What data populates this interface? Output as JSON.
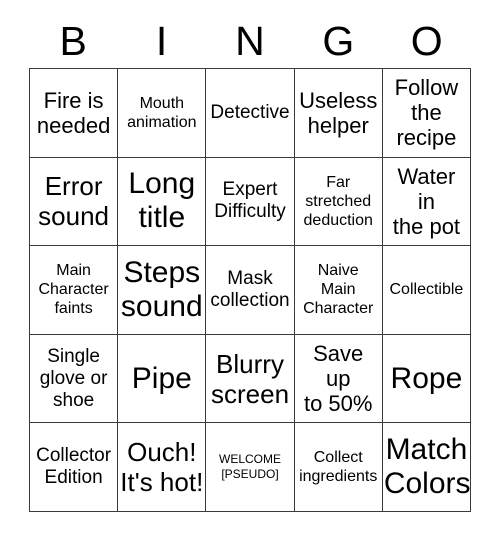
{
  "card": {
    "headers": [
      "B",
      "I",
      "N",
      "G",
      "O"
    ],
    "rows": [
      [
        {
          "text": "Fire is\nneeded",
          "size": "lg"
        },
        {
          "text": "Mouth\nanimation",
          "size": "sm"
        },
        {
          "text": "Detective",
          "size": "md"
        },
        {
          "text": "Useless\nhelper",
          "size": "lg"
        },
        {
          "text": "Follow\nthe\nrecipe",
          "size": "lg"
        }
      ],
      [
        {
          "text": "Error\nsound",
          "size": "xl"
        },
        {
          "text": "Long\ntitle",
          "size": "xxl"
        },
        {
          "text": "Expert\nDifficulty",
          "size": "md"
        },
        {
          "text": "Far\nstretched\ndeduction",
          "size": "sm"
        },
        {
          "text": "Water\nin\nthe pot",
          "size": "lg"
        }
      ],
      [
        {
          "text": "Main\nCharacter\nfaints",
          "size": "sm"
        },
        {
          "text": "Steps\nsound",
          "size": "xxl"
        },
        {
          "text": "Mask\ncollection",
          "size": "md"
        },
        {
          "text": "Naive\nMain\nCharacter",
          "size": "sm"
        },
        {
          "text": "Collectible",
          "size": "sm"
        }
      ],
      [
        {
          "text": "Single\nglove or\nshoe",
          "size": "md"
        },
        {
          "text": "Pipe",
          "size": "xxl"
        },
        {
          "text": "Blurry\nscreen",
          "size": "xl"
        },
        {
          "text": "Save\nup\nto 50%",
          "size": "lg"
        },
        {
          "text": "Rope",
          "size": "xxl"
        }
      ],
      [
        {
          "text": "Collector\nEdition",
          "size": "md"
        },
        {
          "text": "Ouch!\nIt's hot!",
          "size": "xl"
        },
        {
          "text": "WELCOME\n[PSEUDO]",
          "size": "xxs"
        },
        {
          "text": "Collect\ningredients",
          "size": "sm"
        },
        {
          "text": "Match\nColors",
          "size": "xxl"
        }
      ]
    ]
  },
  "style": {
    "border_color": "#3a3a3a",
    "text_color": "#000000",
    "background": "#ffffff"
  }
}
